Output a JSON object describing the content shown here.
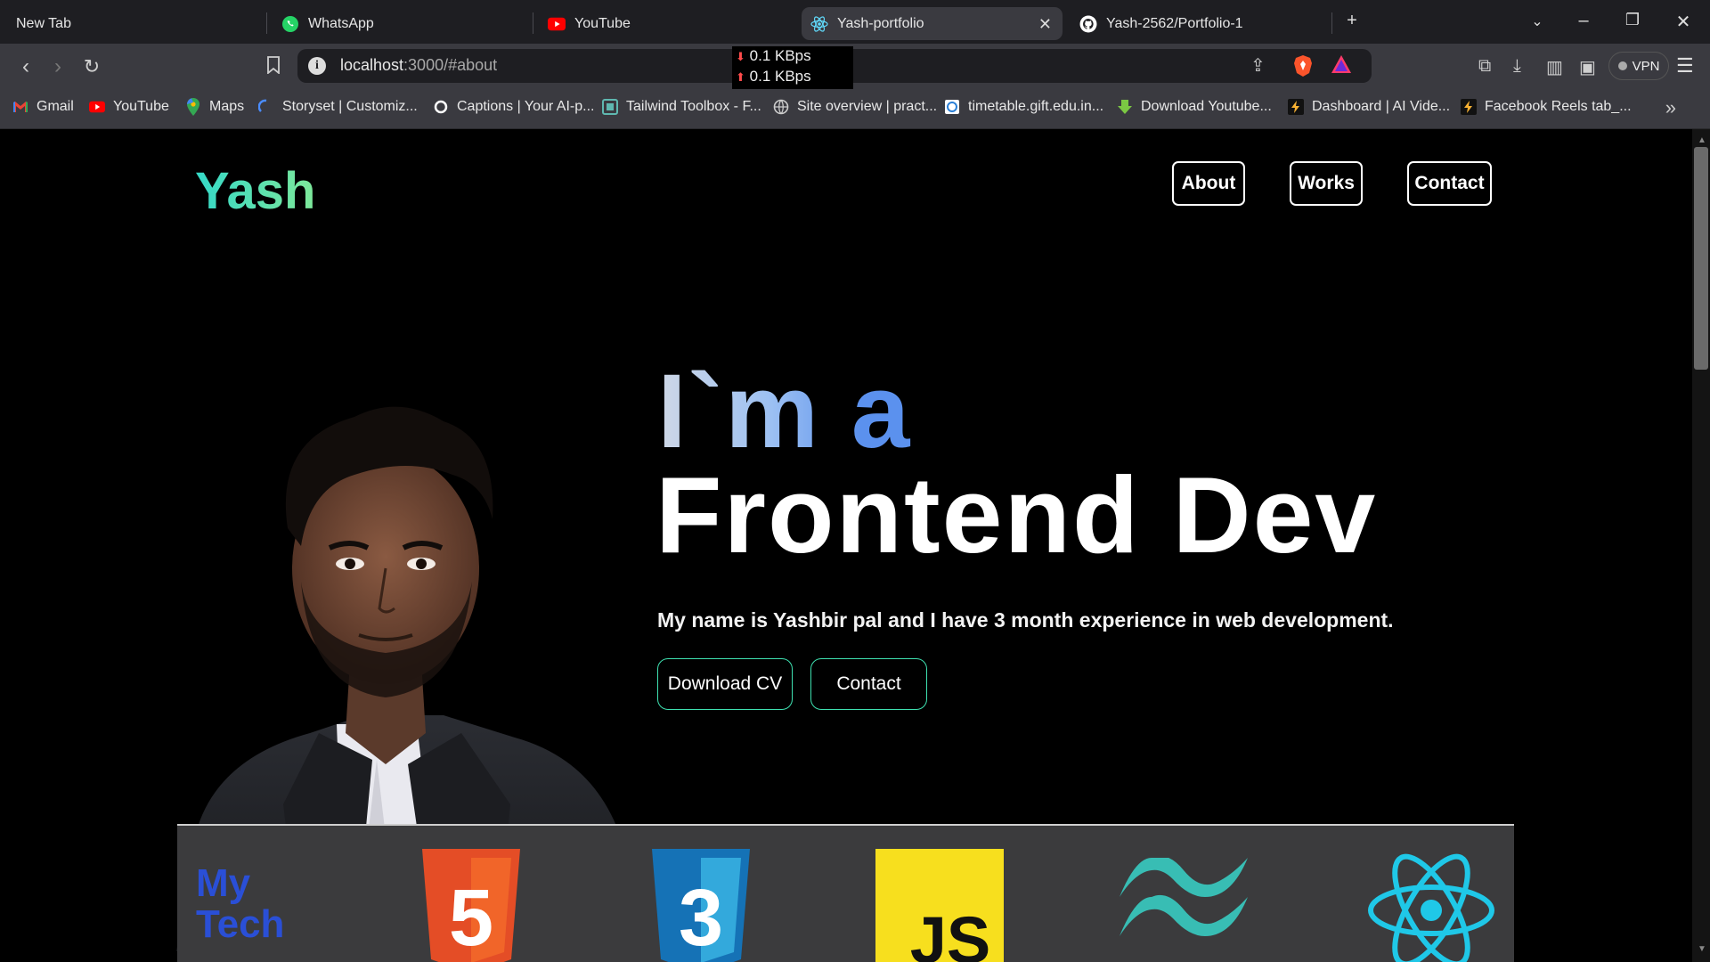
{
  "browser": {
    "tabs": [
      {
        "label": "New Tab",
        "icon": "none",
        "active": false
      },
      {
        "label": "WhatsApp",
        "icon": "whatsapp-icon",
        "active": false
      },
      {
        "label": "YouTube",
        "icon": "youtube-icon",
        "active": false
      },
      {
        "label": "Yash-portfolio",
        "icon": "react-icon",
        "active": true
      },
      {
        "label": "Yash-2562/Portfolio-1",
        "icon": "github-icon",
        "active": false
      }
    ],
    "close_tab_glyph": "✕",
    "new_tab_glyph": "+",
    "url_host": "localhost",
    "url_path": ":3000/#about",
    "network": {
      "down": "0.1 KBps",
      "up": "0.1 KBps"
    },
    "vpn_label": "VPN",
    "bookmarks": [
      {
        "label": "Gmail",
        "icon": "gmail-icon"
      },
      {
        "label": "YouTube",
        "icon": "youtube-icon"
      },
      {
        "label": "Maps",
        "icon": "maps-icon"
      },
      {
        "label": "Storyset | Customiz...",
        "icon": "storyset-icon"
      },
      {
        "label": "Captions | Your AI-p...",
        "icon": "captions-icon"
      },
      {
        "label": "Tailwind Toolbox - F...",
        "icon": "tailwind-toolbox-icon"
      },
      {
        "label": "Site overview | pract...",
        "icon": "globe-icon"
      },
      {
        "label": "timetable.gift.edu.in...",
        "icon": "timetable-icon"
      },
      {
        "label": "Download Youtube...",
        "icon": "download-icon"
      },
      {
        "label": "Dashboard | AI Vide...",
        "icon": "bolt-icon"
      },
      {
        "label": "Facebook Reels tab_...",
        "icon": "bolt-icon"
      }
    ],
    "colors": {
      "tabbar": "#1e1e22",
      "toolbar": "#3a3a40",
      "urlbar": "#1e1e22"
    }
  },
  "site": {
    "logo": "Yash",
    "nav": [
      {
        "label": "About"
      },
      {
        "label": "Works"
      },
      {
        "label": "Contact"
      }
    ],
    "hero": {
      "line1": "I`m a",
      "line2": "Frontend Dev",
      "subtitle": "My name is Yashbir pal and I have 3 month experience in web development.",
      "buttons": [
        {
          "label": "Download CV"
        },
        {
          "label": "Contact"
        }
      ]
    },
    "tech": {
      "heading_line1": "My",
      "heading_line2": "Tech",
      "icons": [
        {
          "name": "html5-icon",
          "text": "5"
        },
        {
          "name": "css3-icon",
          "text": "3"
        },
        {
          "name": "javascript-icon",
          "text": "JS"
        },
        {
          "name": "tailwind-icon"
        },
        {
          "name": "react-icon"
        }
      ]
    },
    "colors": {
      "accent": "#3ee0b0",
      "logo": "#34d9c8",
      "tech_heading": "#2a4fd6",
      "techbar": "#3b3b3d"
    }
  }
}
